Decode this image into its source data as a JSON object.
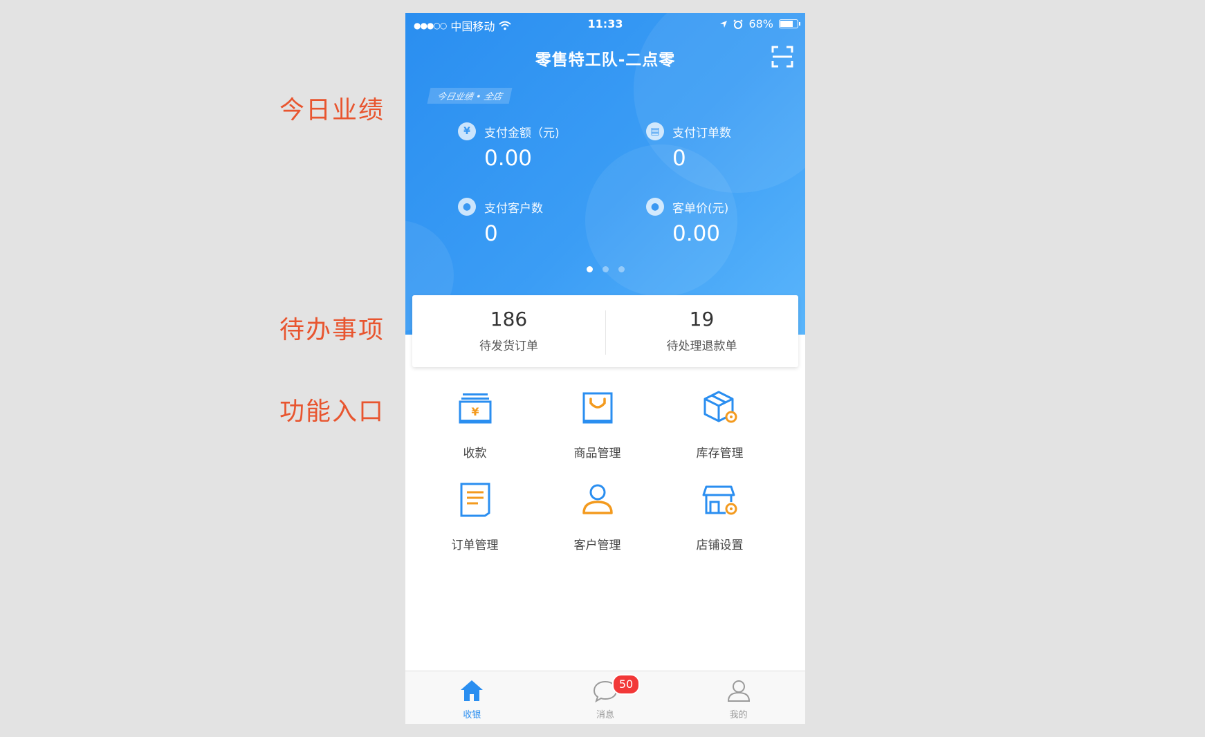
{
  "annotations": {
    "today": "今日业绩",
    "todo": "待办事项",
    "functions": "功能入口"
  },
  "status_bar": {
    "carrier": "中国移动",
    "time": "11:33",
    "battery": "68%"
  },
  "nav": {
    "title": "零售特工队-二点零",
    "scan_icon": "scan-icon"
  },
  "performance": {
    "tag": "今日业绩 • 全店",
    "metrics": [
      {
        "label": "支付金额（元)",
        "value": "0.00",
        "icon": "yuan-icon"
      },
      {
        "label": "支付订单数",
        "value": "0",
        "icon": "order-icon"
      },
      {
        "label": "支付客户数",
        "value": "0",
        "icon": "user-icon"
      },
      {
        "label": "客单价(元)",
        "value": "0.00",
        "icon": "user-price-icon"
      }
    ],
    "pager": {
      "count": 3,
      "active": 0
    }
  },
  "todo": {
    "items": [
      {
        "count": "186",
        "label": "待发货订单"
      },
      {
        "count": "19",
        "label": "待处理退款单"
      }
    ]
  },
  "functions": {
    "items": [
      {
        "label": "收款",
        "icon": "cashier-icon"
      },
      {
        "label": "商品管理",
        "icon": "goods-bag-icon"
      },
      {
        "label": "库存管理",
        "icon": "inventory-box-icon"
      },
      {
        "label": "订单管理",
        "icon": "order-list-icon"
      },
      {
        "label": "客户管理",
        "icon": "customer-icon"
      },
      {
        "label": "店铺设置",
        "icon": "store-settings-icon"
      }
    ]
  },
  "tabbar": {
    "items": [
      {
        "label": "收银",
        "icon": "home-icon",
        "active": true
      },
      {
        "label": "消息",
        "icon": "message-icon",
        "badge": "50"
      },
      {
        "label": "我的",
        "icon": "profile-icon"
      }
    ]
  },
  "colors": {
    "primary": "#2a8ef0",
    "accent_orange": "#f39a1e",
    "badge_red": "#f23838",
    "annotation": "#e8552f"
  }
}
